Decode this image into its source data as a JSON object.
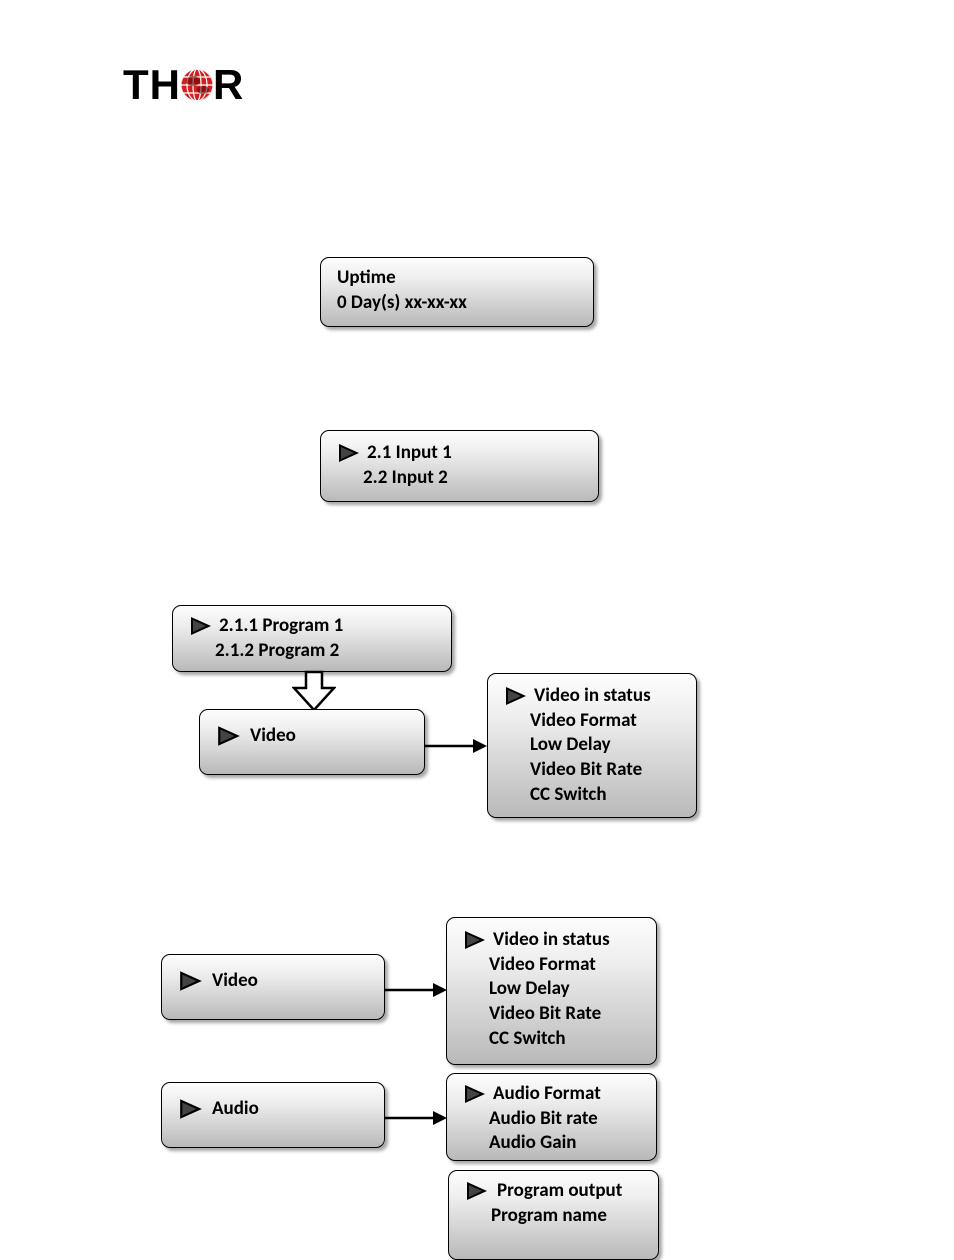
{
  "logo": {
    "text_left": "TH",
    "text_right": "R"
  },
  "uptime": {
    "line1": "Uptime",
    "line2": "0 Day(s) xx-xx-xx"
  },
  "inputs": {
    "item1": "2.1 Input 1",
    "item2": "2.2 Input 2"
  },
  "programs": {
    "item1": "2.1.1 Program 1",
    "item2": "2.1.2 Program 2"
  },
  "video_node": {
    "label": "Video"
  },
  "video_detail": {
    "l1": "Video in status",
    "l2": "Video Format",
    "l3": "Low Delay",
    "l4": "Video Bit Rate",
    "l5": "CC Switch"
  },
  "video_node2": {
    "label": "Video"
  },
  "video_detail2": {
    "l1": "Video in status",
    "l2": "Video Format",
    "l3": "Low Delay",
    "l4": "Video Bit Rate",
    "l5": "CC Switch"
  },
  "audio_node": {
    "label": "Audio"
  },
  "audio_detail": {
    "l1": "Audio Format",
    "l2": "Audio Bit rate",
    "l3": "Audio Gain"
  },
  "prog_detail": {
    "l1": "Program output",
    "l2": "Program name"
  }
}
